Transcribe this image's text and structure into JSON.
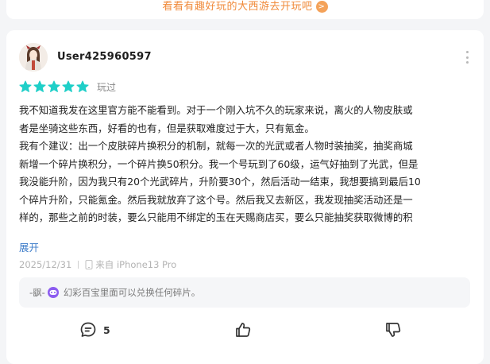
{
  "top_banner": {
    "text": "看看有趣好玩的大西游去开玩吧",
    "badge": ">"
  },
  "review": {
    "username": "User425960597",
    "stars": 5,
    "star_color": "#1fcfc8",
    "status": "玩过",
    "body": "我不知道我发在这里官方能不能看到。对于一个刚入坑不久的玩家来说，离火的人物皮肤或\n者是坐骑这些东西，好看的也有，但是获取难度过于大，只有氪金。\n我有个建议：出一个皮肤碎片换积分的机制，就每一次的光武或者人物时装抽奖，抽奖商城\n新增一个碎片换积分，一个碎片换50积分。我一个号玩到了60级，运气好抽到了光武，但是\n我没能升阶，因为我只有20个光武碎片，升阶要30个，然后活动一结束，我想要搞到最后10\n个碎片升阶，只能氪金。然后我就放弃了这个号。然后我又去新区，我发现抽奖活动还是一\n样的，那些之前的时装，要么只能用不绑定的玉在天赐商店买，要么只能抽奖获取微博的积",
    "expand_label": "展开",
    "date": "2025/12/31",
    "device": "来自 iPhone13 Pro"
  },
  "reply": {
    "author": "-飖-",
    "text": "幻彩百宝里面可以兑换任何碎片。"
  },
  "actions": {
    "comment_count": "5",
    "like_count": "",
    "dislike_count": ""
  },
  "colors": {
    "accent_orange": "#f08a3a",
    "link_blue": "#3d7cc9",
    "game_icon": "#8c5cf0"
  },
  "icons": [
    "avatar",
    "more-icon",
    "star-icon",
    "phone-icon",
    "game-icon",
    "comment-icon",
    "thumbs-up-icon",
    "thumbs-down-icon"
  ]
}
